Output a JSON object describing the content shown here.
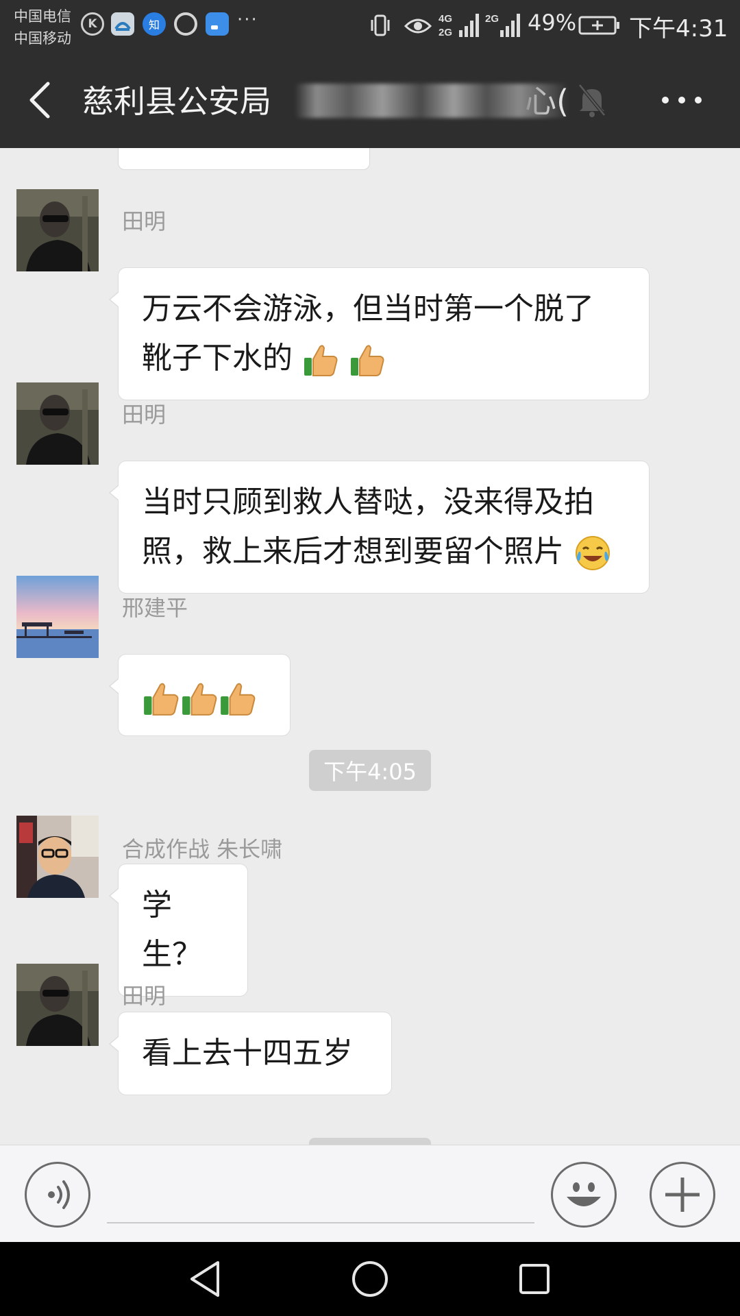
{
  "status_bar": {
    "carrier_1": "中国电信",
    "carrier_2": "中国移动",
    "app_icon_zhi": "知",
    "app_icon_k": "K",
    "more_dots": "···",
    "battery_percent": "49%",
    "time": "下午4:31",
    "icons": [
      "k-app-icon",
      "news-app-icon",
      "zhihu-icon",
      "q-app-icon",
      "app-square-icon",
      "vibrate-icon",
      "eye-icon",
      "signal-4g-icon",
      "signal-2g-icon",
      "battery-charging-icon"
    ]
  },
  "header": {
    "title": "慈利县公安局",
    "title_tail": "心(",
    "icons": [
      "back-arrow-icon",
      "mute-bell-icon",
      "more-dots-icon"
    ]
  },
  "messages": [
    {
      "sender": "田明",
      "line1": "万云不会游泳，但当时第一个脱了",
      "line2": "靴子下水的",
      "emoji": [
        "thumbs-up-icon",
        "thumbs-up-icon"
      ]
    },
    {
      "sender": "田明",
      "line1": "当时只顾到救人替哒，没来得及拍",
      "line2": "照，救上来后才想到要留个照片",
      "emoji": [
        "laugh-cry-emoji-icon"
      ]
    },
    {
      "sender": "邢建平",
      "emoji": [
        "thumbs-up-icon",
        "thumbs-up-icon",
        "thumbs-up-icon"
      ]
    },
    {
      "sender": "合成作战  朱长啸",
      "text": "学生？"
    },
    {
      "sender": "田明",
      "text": "看上去十四五岁"
    }
  ],
  "time_divider": "下午4:05",
  "input_bar": {
    "placeholder": "",
    "icons": [
      "voice-icon",
      "emoji-face-icon",
      "plus-icon"
    ]
  },
  "system_nav": {
    "icons": [
      "nav-back-triangle-icon",
      "nav-home-circle-icon",
      "nav-recents-square-icon"
    ]
  },
  "colors": {
    "status_bg": "#2e2e2e",
    "chat_bg": "#ececec",
    "bubble_bg": "#ffffff",
    "sender_text": "#9a9a9a"
  }
}
